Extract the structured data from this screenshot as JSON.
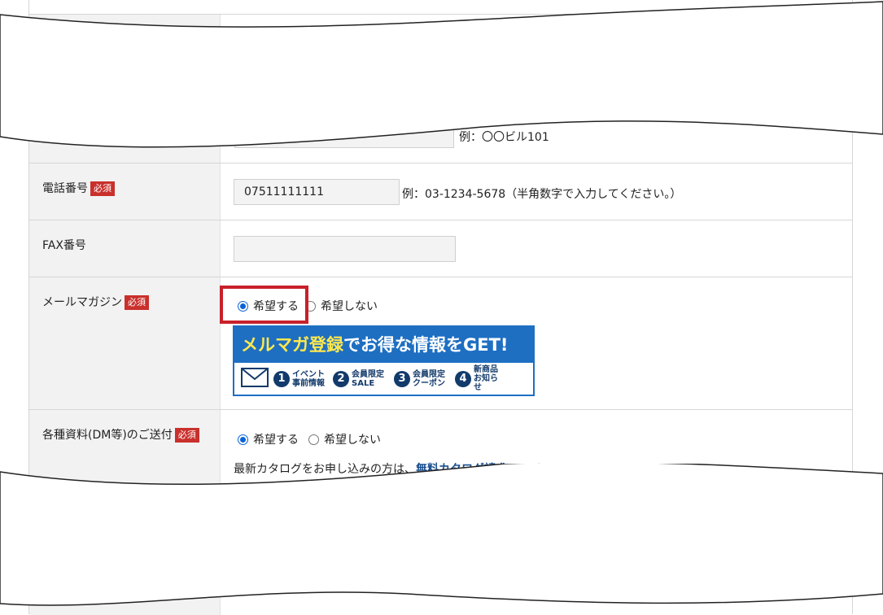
{
  "required_badge": "必須",
  "address_hint": "例：〇〇ビル101",
  "phone": {
    "label": "電話番号",
    "value": "07511111111",
    "hint": "例：03-1234-5678（半角数字で入力してください。）"
  },
  "fax": {
    "label": "FAX番号",
    "value": ""
  },
  "mail_magazine": {
    "label": "メールマガジン",
    "options": [
      "希望する",
      "希望しない"
    ],
    "selected": "希望する",
    "banner": {
      "headline_parts": [
        "メルマガ登録",
        "でお得な情報をGET!"
      ],
      "items": [
        {
          "num": "1",
          "label": "イベント事前情報"
        },
        {
          "num": "2",
          "label": "会員限定SALE"
        },
        {
          "num": "3",
          "label": "会員限定クーポン"
        },
        {
          "num": "4",
          "label": "新商品お知らせ"
        }
      ]
    },
    "icons": {
      "mail": "envelope-icon"
    }
  },
  "dm": {
    "label": "各種資料(DM等)のご送付",
    "options": [
      "希望する",
      "希望しない"
    ],
    "selected": "希望する",
    "note_prefix": "最新カタログをお申し込みの方は、",
    "note_link": "無料カタログ請求ページ"
  },
  "colors": {
    "required": "#c9302c",
    "highlight": "#c8202a",
    "banner": "#1e6fc2",
    "radio": "#0a63d6"
  }
}
